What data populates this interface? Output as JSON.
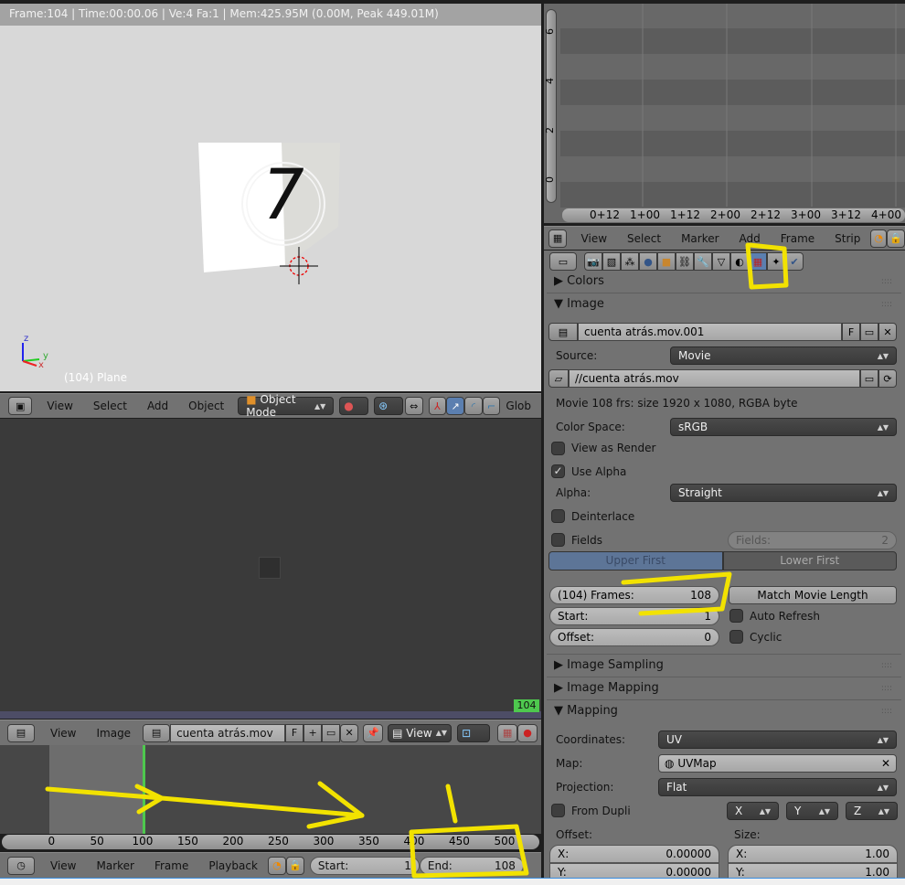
{
  "info": {
    "text": "Frame:104 | Time:00:00.06 | Ve:4 Fa:1 | Mem:425.95M (0.00M, Peak 449.01M)"
  },
  "viewport": {
    "object_label": "(104) Plane",
    "digit": "7",
    "axes": {
      "x": "x",
      "y": "y",
      "z": "z"
    }
  },
  "view3d_header": {
    "menus": [
      "View",
      "Select",
      "Add",
      "Object"
    ],
    "mode": "Object Mode",
    "orientation": "Glob"
  },
  "graph": {
    "y_ticks": [
      "6",
      "4",
      "2",
      "0"
    ],
    "x_ticks": [
      "0+12",
      "1+00",
      "1+12",
      "2+00",
      "2+12",
      "3+00",
      "3+12",
      "4+00"
    ]
  },
  "sequencer_header": {
    "menus": [
      "View",
      "Select",
      "Marker",
      "Add",
      "Frame",
      "Strip"
    ]
  },
  "properties": {
    "colors_panel": "Colors",
    "image_panel": "Image",
    "image_name": "cuenta atrás.mov.001",
    "fake_user": "F",
    "source_label": "Source:",
    "source_value": "Movie",
    "filepath": "//cuenta atrás.mov",
    "info": "Movie 108 frs: size 1920 x 1080, RGBA byte",
    "color_space_label": "Color Space:",
    "color_space_value": "sRGB",
    "view_as_render": "View as Render",
    "use_alpha": "Use Alpha",
    "use_alpha_check": "✓",
    "alpha_label": "Alpha:",
    "alpha_value": "Straight",
    "deinterlace": "Deinterlace",
    "fields": "Fields",
    "fields_num_label": "Fields:",
    "fields_num_value": "2",
    "upper_first": "Upper First",
    "lower_first": "Lower First",
    "frames_label": "(104) Frames:",
    "frames_value": "108",
    "match_movie": "Match Movie Length",
    "start_label": "Start:",
    "start_value": "1",
    "auto_refresh": "Auto Refresh",
    "offset_label": "Offset:",
    "offset_value": "0",
    "cyclic": "Cyclic",
    "image_sampling": "Image Sampling",
    "image_mapping": "Image Mapping",
    "mapping": "Mapping",
    "coordinates_label": "Coordinates:",
    "coordinates_value": "UV",
    "map_label": "Map:",
    "map_value": "UVMap",
    "projection_label": "Projection:",
    "projection_value": "Flat",
    "from_dupli": "From Dupli",
    "axes": [
      "X",
      "Y",
      "Z"
    ],
    "offset_heading": "Offset:",
    "size_heading": "Size:",
    "offset_x_label": "X:",
    "offset_x": "0.00000",
    "offset_y_label": "Y:",
    "offset_y": "0.00000",
    "size_x_label": "X:",
    "size_x": "1.00",
    "size_y_label": "Y:",
    "size_y": "1.00"
  },
  "image_editor": {
    "current_frame": "104",
    "menus": [
      "View",
      "Image"
    ],
    "image_name": "cuenta atrás.mov",
    "fake_user": "F",
    "view_mode": "View"
  },
  "timeline": {
    "ruler": [
      "0",
      "50",
      "100",
      "150",
      "200",
      "250",
      "300",
      "350",
      "400",
      "450",
      "500"
    ],
    "menus": [
      "View",
      "Marker",
      "Frame",
      "Playback"
    ],
    "start_label": "Start:",
    "start_value": "1",
    "end_label": "End:",
    "end_value": "108",
    "current_frame": 104
  },
  "annotation_color": "#f2e200"
}
